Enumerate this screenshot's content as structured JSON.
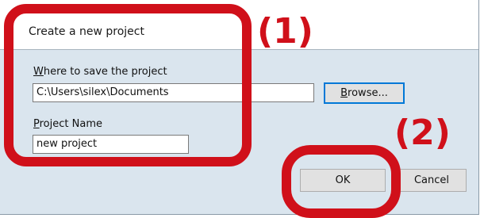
{
  "dialog": {
    "title": "Create a new project",
    "save_location": {
      "label_prefix": "",
      "label_accel": "W",
      "label_rest": "here to save the project",
      "value": "C:\\Users\\silex\\Documents"
    },
    "browse_button": {
      "label_accel": "B",
      "label_rest": "rowse..."
    },
    "project_name": {
      "label_accel": "P",
      "label_rest": "roject Name",
      "value": "new project"
    },
    "ok_label": "OK",
    "cancel_label": "Cancel"
  },
  "annotations": {
    "step1": "(1)",
    "step2": "(2)",
    "color": "#d0101a"
  }
}
